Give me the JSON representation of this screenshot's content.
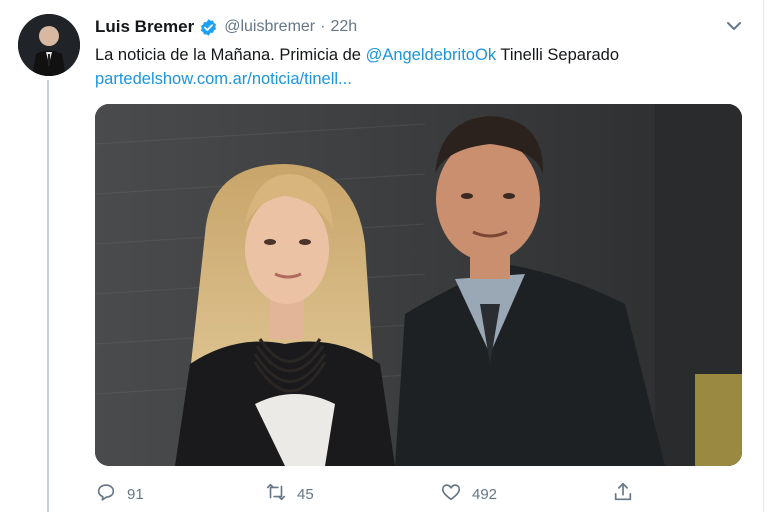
{
  "tweet": {
    "display_name": "Luis Bremer",
    "handle": "@luisbremer",
    "separator": "·",
    "time": "22h",
    "text_before": "La noticia de la Mañana. Primicia de ",
    "mention": "@AngeldebritoOk",
    "text_after": " Tinelli Separado",
    "link": "partedelshow.com.ar/noticia/tinell...",
    "verified_icon": "verified-badge-icon",
    "menu_icon": "chevron-down-icon",
    "image_alt": "photo-of-couple"
  },
  "actions": {
    "reply_count": "91",
    "retweet_count": "45",
    "like_count": "492"
  },
  "colors": {
    "link": "#1b95e0",
    "secondary_text": "#657786",
    "verified": "#1da1f2"
  }
}
